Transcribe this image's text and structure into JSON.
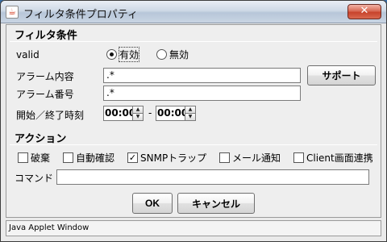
{
  "window": {
    "title": "フィルタ条件プロパティ",
    "app_icon": "java-cup-icon",
    "close_glyph": "✕",
    "status": "Java Applet Window"
  },
  "filter_group": {
    "title": "フィルタ条件",
    "valid_label": "valid",
    "radio_enabled": "有効",
    "radio_disabled": "無効",
    "selected": "有効",
    "alarm_content_label": "アラーム内容",
    "alarm_content_value": ".*",
    "alarm_number_label": "アラーム番号",
    "alarm_number_value": ".*",
    "time_label": "開始／終了時刻",
    "start_time": "00:00",
    "time_separator": "-",
    "end_time": "00:00",
    "support_button": "サポート"
  },
  "action_group": {
    "title": "アクション",
    "checkboxes": [
      {
        "label": "破棄",
        "checked": false
      },
      {
        "label": "自動確認",
        "checked": false
      },
      {
        "label": "SNMPトラップ",
        "checked": true
      },
      {
        "label": "メール通知",
        "checked": false
      },
      {
        "label": "Client画面連携",
        "checked": false
      }
    ],
    "command_label": "コマンド",
    "command_value": ""
  },
  "buttons": {
    "ok": "OK",
    "cancel": "キャンセル"
  }
}
